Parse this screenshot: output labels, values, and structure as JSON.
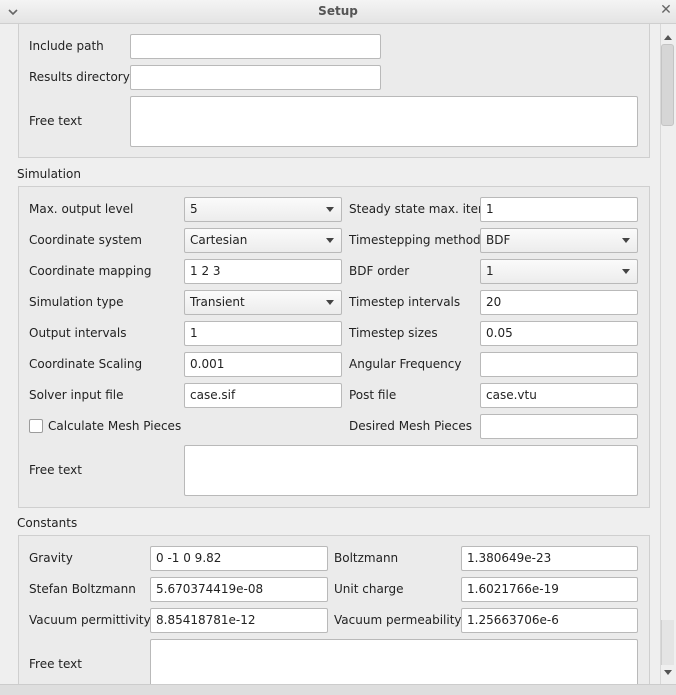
{
  "window": {
    "title": "Setup"
  },
  "general": {
    "include_path": {
      "label": "Include path",
      "value": ""
    },
    "results_directory": {
      "label": "Results directory",
      "value": ""
    },
    "free_text": {
      "label": "Free text",
      "value": ""
    }
  },
  "simulation": {
    "title": "Simulation",
    "max_output_level": {
      "label": "Max. output level",
      "value": "5"
    },
    "coordinate_system": {
      "label": "Coordinate system",
      "value": "Cartesian"
    },
    "coordinate_mapping": {
      "label": "Coordinate mapping",
      "value": "1 2 3"
    },
    "simulation_type": {
      "label": "Simulation type",
      "value": "Transient"
    },
    "output_intervals": {
      "label": "Output intervals",
      "value": "1"
    },
    "coordinate_scaling": {
      "label": "Coordinate Scaling",
      "value": "0.001"
    },
    "solver_input_file": {
      "label": "Solver input file",
      "value": "case.sif"
    },
    "calculate_mesh_pieces": {
      "label": "Calculate Mesh Pieces",
      "checked": false
    },
    "steady_state_max_iter": {
      "label": "Steady state max. iter",
      "value": "1"
    },
    "timestepping_method": {
      "label": "Timestepping method",
      "value": "BDF"
    },
    "bdf_order": {
      "label": "BDF order",
      "value": "1"
    },
    "timestep_intervals": {
      "label": "Timestep intervals",
      "value": "20"
    },
    "timestep_sizes": {
      "label": "Timestep sizes",
      "value": "0.05"
    },
    "angular_frequency": {
      "label": "Angular Frequency",
      "value": ""
    },
    "post_file": {
      "label": "Post file",
      "value": "case.vtu"
    },
    "desired_mesh_pieces": {
      "label": "Desired Mesh Pieces",
      "value": ""
    },
    "free_text": {
      "label": "Free text",
      "value": ""
    }
  },
  "constants": {
    "title": "Constants",
    "gravity": {
      "label": "Gravity",
      "value": "0 -1 0 9.82"
    },
    "stefan_boltzmann": {
      "label": "Stefan Boltzmann",
      "value": "5.670374419e-08"
    },
    "vacuum_permittivity": {
      "label": "Vacuum permittivity",
      "value": "8.85418781e-12"
    },
    "boltzmann": {
      "label": "Boltzmann",
      "value": "1.380649e-23"
    },
    "unit_charge": {
      "label": "Unit charge",
      "value": "1.6021766e-19"
    },
    "vacuum_permeability": {
      "label": "Vacuum permeability",
      "value": "1.25663706e-6"
    },
    "free_text": {
      "label": "Free text",
      "value": ""
    }
  }
}
